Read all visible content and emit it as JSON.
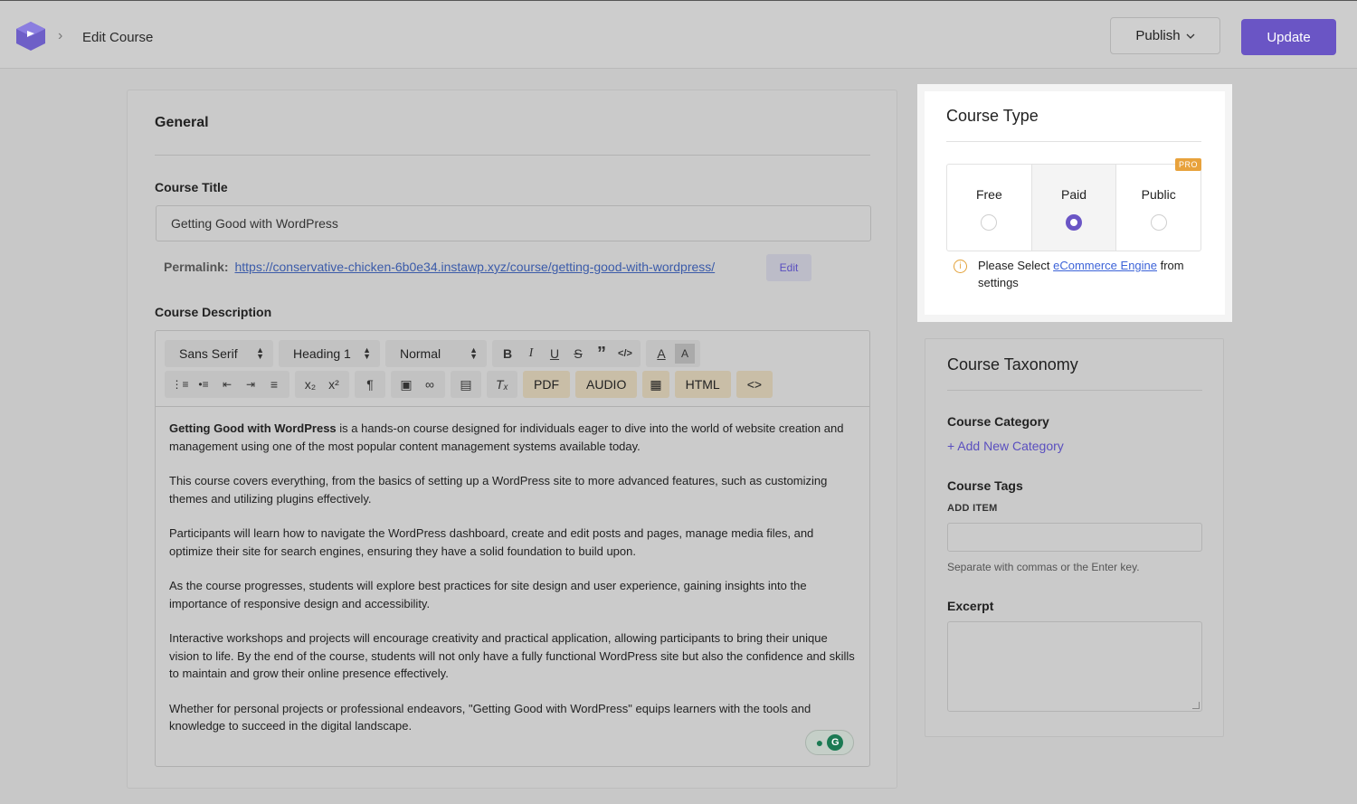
{
  "header": {
    "breadcrumb": "Edit Course",
    "publish_label": "Publish",
    "update_label": "Update"
  },
  "general": {
    "title": "General",
    "course_title_label": "Course Title",
    "course_title_value": "Getting Good with WordPress",
    "permalink_label": "Permalink:",
    "permalink_url": "https://conservative-chicken-6b0e34.instawp.xyz/course/getting-good-with-wordpress/",
    "permalink_edit": "Edit",
    "description_label": "Course Description"
  },
  "toolbar": {
    "font": "Sans Serif",
    "heading": "Heading 1",
    "size": "Normal",
    "pdf": "PDF",
    "audio": "AUDIO",
    "html": "HTML",
    "code": "<>"
  },
  "description": {
    "p1_bold": "Getting Good with WordPress",
    "p1_rest": " is a hands-on course designed for individuals eager to dive into the world of website creation and management using one of the most popular content management systems available today.",
    "p2": "This course covers everything, from the basics of setting up a WordPress site to more advanced features, such as customizing themes and utilizing plugins effectively.",
    "p3": "Participants will learn how to navigate the WordPress dashboard, create and edit posts and pages, manage media files, and optimize their site for search engines, ensuring they have a solid foundation to build upon.",
    "p4": "As the course progresses, students will explore best practices for site design and user experience, gaining insights into the importance of responsive design and accessibility.",
    "p5": "Interactive workshops and projects will encourage creativity and practical application, allowing participants to bring their unique vision to life. By the end of the course, students will not only have a fully functional WordPress site but also the confidence and skills to maintain and grow their online presence effectively.",
    "p6": "Whether for personal projects or professional endeavors, \"Getting Good with WordPress\" equips learners with the tools and knowledge to succeed in the digital landscape."
  },
  "course_type": {
    "title": "Course Type",
    "options": [
      {
        "label": "Free",
        "selected": false
      },
      {
        "label": "Paid",
        "selected": true
      },
      {
        "label": "Public",
        "selected": false,
        "badge": "PRO"
      }
    ],
    "notice_prefix": "Please Select ",
    "notice_link": "eCommerce Engine",
    "notice_suffix": " from settings"
  },
  "taxonomy": {
    "title": "Course Taxonomy",
    "category_label": "Course Category",
    "add_category": "+ Add New Category",
    "tags_label": "Course Tags",
    "add_item_label": "ADD ITEM",
    "tags_help": "Separate with commas or the Enter key.",
    "excerpt_label": "Excerpt"
  },
  "colors": {
    "accent": "#6a55c5",
    "pro_badge": "#e8a23c",
    "overlay_bg": "#c8c8c8"
  }
}
